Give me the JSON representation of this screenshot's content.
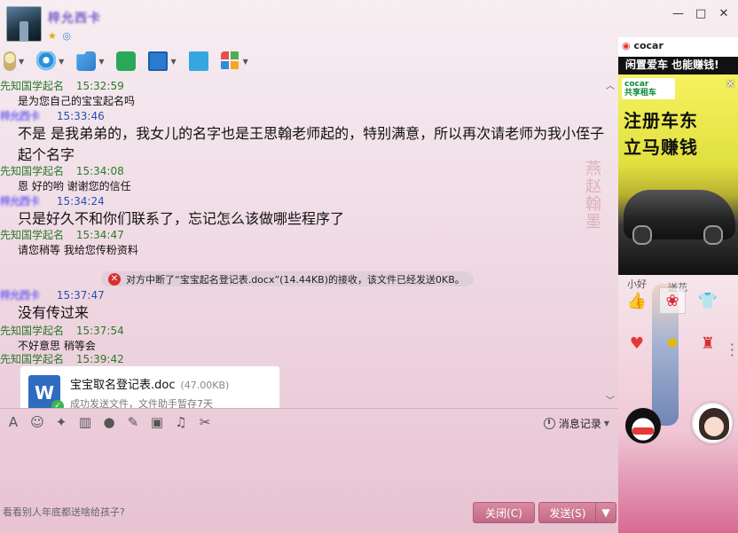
{
  "window": {
    "contact_name": "梓允西卡",
    "controls": [
      "—",
      "□",
      "✕"
    ]
  },
  "toolbar": {
    "items": [
      {
        "icon": "microphone-icon"
      },
      {
        "icon": "webcam-icon"
      },
      {
        "icon": "send-file-icon"
      },
      {
        "icon": "new-message-icon"
      },
      {
        "icon": "remote-desktop-icon"
      },
      {
        "icon": "screen-share-icon"
      },
      {
        "icon": "apps-icon"
      }
    ]
  },
  "chat": {
    "messages": [
      {
        "sender": "先知国学起名",
        "time": "15:32:59",
        "text": "是为您自己的宝宝起名吗",
        "self": false
      },
      {
        "sender": "梓允西卡",
        "time": "15:33:46",
        "text": "不是  是我弟弟的，我女儿的名字也是王思翰老师起的，特别满意，所以再次请老师为我小侄子起个名字",
        "self": true
      },
      {
        "sender": "先知国学起名",
        "time": "15:34:08",
        "text": "恩  好的哟 谢谢您的信任",
        "self": false
      },
      {
        "sender": "梓允西卡",
        "time": "15:34:24",
        "text": "只是好久不和你们联系了，忘记怎么该做哪些程序了",
        "self": true
      },
      {
        "sender": "先知国学起名",
        "time": "15:34:47",
        "text": "请您稍等  我给您传粉资料",
        "self": false
      },
      {
        "sender": "梓允西卡",
        "time": "15:37:47",
        "text": "没有传过来",
        "self": true
      },
      {
        "sender": "先知国学起名",
        "time": "15:37:54",
        "text": "不好意思  稍等会",
        "self": false
      },
      {
        "sender": "先知国学起名",
        "time": "15:39:42",
        "text": "",
        "self": false
      }
    ],
    "notice": "对方中断了“宝宝起名登记表.docx”(14.44KB)的接收，该文件已经发送0KB。",
    "file": {
      "name": "宝宝取名登记表.doc",
      "size": "(47.00KB)",
      "status": "成功发送文件，文件助手暂存7天"
    },
    "seal_text": "燕赵翰墨"
  },
  "input": {
    "history_label": "消息记录",
    "hint": "看看别人年底都送啥给孩子?",
    "close_label": "关闭(C)",
    "send_label": "发送(S)"
  },
  "side": {
    "ad_top_brand": "cocar",
    "ad_top_slogan": "闲置爱车 也能赚钱!",
    "ad_brand": "cocar",
    "ad_brand_sub": "共享租车",
    "ad_line1": "注册车东",
    "ad_line2": "立马赚钱",
    "show_bubble_left": "小好",
    "show_bubble_right": "送花"
  },
  "colors": {
    "accent": "#c26a85",
    "sender_other": "#2a7a2a",
    "sender_self": "#2451b0"
  }
}
